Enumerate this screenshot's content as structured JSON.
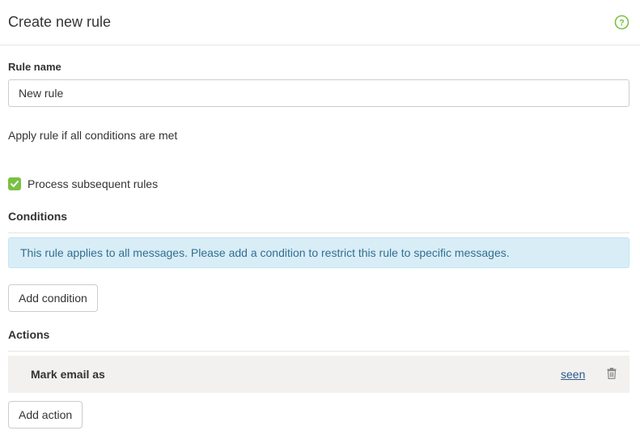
{
  "header": {
    "title": "Create new rule",
    "help_icon": "question-circle-icon",
    "accent_color": "#7ac143"
  },
  "form": {
    "rule_name_label": "Rule name",
    "rule_name_value": "New rule",
    "apply_text": "Apply rule if all conditions are met",
    "process_subsequent": {
      "label": "Process subsequent rules",
      "checked": true
    }
  },
  "conditions": {
    "heading": "Conditions",
    "info_message": "This rule applies to all messages. Please add a condition to restrict this rule to specific messages.",
    "add_button": "Add condition"
  },
  "actions": {
    "heading": "Actions",
    "items": [
      {
        "label": "Mark email as",
        "value": "seen",
        "delete_icon": "trash-icon"
      }
    ],
    "add_button": "Add action"
  }
}
